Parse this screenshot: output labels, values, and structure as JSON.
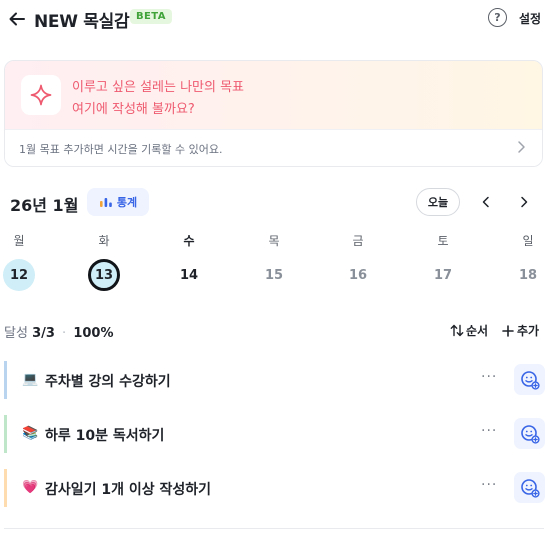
{
  "header": {
    "back_icon": "arrow-left-icon",
    "title": "NEW 목실감",
    "badge": "BETA",
    "help_icon": "question-circle-icon",
    "help_glyph": "?",
    "settings_label": "설정"
  },
  "goal_card": {
    "icon": "sparkle-icon",
    "line1": "이루고 싶은 설레는 나만의 목표",
    "line2": "여기에 작성해 볼까요?",
    "hint": "1월 목표  추가하면 시간을 기록할 수 있어요.",
    "chevron_icon": "chevron-right-icon"
  },
  "calendar": {
    "month_label": "26년 1월",
    "stats_label": "통계",
    "stats_icon": "bar-chart-icon",
    "today_label": "오늘",
    "prev_icon": "chevron-left-icon",
    "next_icon": "chevron-right-icon",
    "weekdays": [
      "월",
      "화",
      "수",
      "목",
      "금",
      "토",
      "일"
    ],
    "days": [
      "12",
      "13",
      "14",
      "15",
      "16",
      "17",
      "18"
    ]
  },
  "progress": {
    "label": "달성",
    "count": "3/3",
    "separator": "·",
    "percent": "100%",
    "order_label": "순서",
    "order_icon": "sort-arrows-icon",
    "add_label": "추가",
    "add_icon": "plus-icon"
  },
  "tasks": [
    {
      "emoji": "💻",
      "label": "주차별 강의 수강하기",
      "accent": "#b9d4ef",
      "more": "···"
    },
    {
      "emoji": "📚",
      "label": "하루 10분 독서하기",
      "accent": "#bfe6c8",
      "more": "···"
    },
    {
      "emoji": "💗",
      "label": "감사일기 1개 이상 작성하기",
      "accent": "#ffdcb0",
      "more": "···"
    }
  ],
  "colors": {
    "accent_blue": "#3864e6",
    "goal_pink": "#ee5a6f",
    "beta_green": "#3fa33a",
    "day_fill": "#cfeef7"
  }
}
